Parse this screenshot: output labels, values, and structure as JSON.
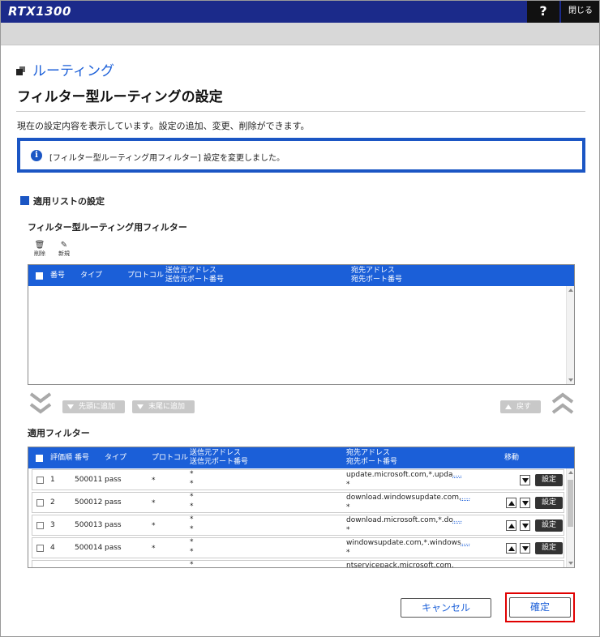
{
  "app": {
    "logo": "RTX1300",
    "help_label": "?",
    "close_label": "閉じる"
  },
  "section": {
    "title": "ルーティング",
    "icon": "window-stack-icon"
  },
  "page": {
    "title": "フィルター型ルーティングの設定",
    "description": "現在の設定内容を表示しています。設定の追加、変更、削除ができます。"
  },
  "notice": {
    "icon": "info-icon",
    "text": "[フィルター型ルーティング用フィルター] 設定を変更しました。"
  },
  "apply_list": {
    "heading": "適用リストの設定"
  },
  "filter_table": {
    "heading": "フィルター型ルーティング用フィルター",
    "toolbar": {
      "delete_label": "削除",
      "new_label": "新規"
    },
    "columns": {
      "number": "番号",
      "type": "タイプ",
      "protocol": "プロトコル",
      "src_addr": "送信元アドレス",
      "src_port": "送信元ポート番号",
      "dst_addr": "宛先アドレス",
      "dst_port": "宛先ポート番号"
    },
    "rows": []
  },
  "move_bar": {
    "add_top": "先頭に追加",
    "add_bottom": "末尾に追加",
    "back": "戻す"
  },
  "applied_table": {
    "heading": "適用フィルター",
    "columns": {
      "priority": "評価順",
      "number": "番号",
      "type": "タイプ",
      "protocol": "プロトコル",
      "src_addr": "送信元アドレス",
      "src_port": "送信元ポート番号",
      "dst_addr": "宛先アドレス",
      "dst_port": "宛先ポート番号",
      "move": "移動"
    },
    "set_label": "設定",
    "rows": [
      {
        "priority": "1",
        "number": "500011",
        "type": "pass",
        "protocol": "*",
        "src_addr": "*",
        "src_port": "*",
        "dst_addr": "update.microsoft.com,*.upda",
        "dst_more": "....",
        "dst_port": "*"
      },
      {
        "priority": "2",
        "number": "500012",
        "type": "pass",
        "protocol": "*",
        "src_addr": "*",
        "src_port": "*",
        "dst_addr": "download.windowsupdate.com,",
        "dst_more": "....",
        "dst_port": "*"
      },
      {
        "priority": "3",
        "number": "500013",
        "type": "pass",
        "protocol": "*",
        "src_addr": "*",
        "src_port": "*",
        "dst_addr": "download.microsoft.com,*.do",
        "dst_more": "....",
        "dst_port": "*"
      },
      {
        "priority": "4",
        "number": "500014",
        "type": "pass",
        "protocol": "*",
        "src_addr": "*",
        "src_port": "*",
        "dst_addr": "windowsupdate.com,*.windows",
        "dst_more": "....",
        "dst_port": "*"
      },
      {
        "priority": "",
        "number": "",
        "type": "",
        "protocol": "",
        "src_addr": "*",
        "src_port": "",
        "dst_addr": "ntservicepack.microsoft.com,",
        "dst_more": "",
        "dst_port": ""
      }
    ]
  },
  "footer": {
    "cancel_label": "キャンセル",
    "confirm_label": "確定"
  },
  "colors": {
    "topbar": "#1b2a8a",
    "accent": "#1b5fd8",
    "highlight": "#e00000"
  }
}
